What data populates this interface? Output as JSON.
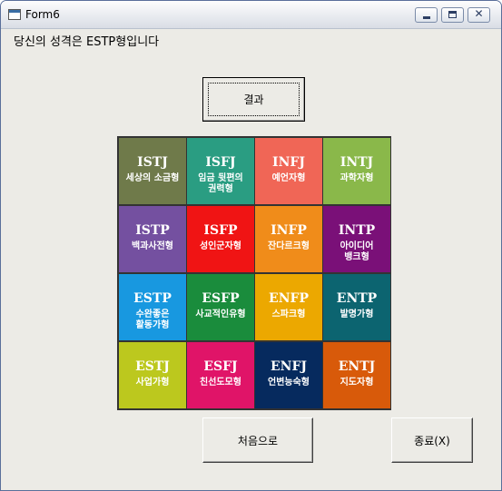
{
  "window": {
    "title": "Form6"
  },
  "title_icons": {
    "app": "form-icon",
    "minimize": "minimize-icon",
    "maximize": "maximize-icon",
    "close": "close-icon"
  },
  "result_text": "당신의 성격은 ESTP형입니다",
  "buttons": {
    "result": "결과",
    "home": "처음으로",
    "exit": "종료(X)"
  },
  "types": [
    {
      "code": "ISTJ",
      "desc": "세상의 소금형",
      "color": "#6f7a4a"
    },
    {
      "code": "ISFJ",
      "desc": "임금 뒷편의\n권력형",
      "color": "#2a9d82"
    },
    {
      "code": "INFJ",
      "desc": "예언자형",
      "color": "#f06656"
    },
    {
      "code": "INTJ",
      "desc": "과학자형",
      "color": "#8ab84a"
    },
    {
      "code": "ISTP",
      "desc": "백과사전형",
      "color": "#7450a0"
    },
    {
      "code": "ISFP",
      "desc": "성인군자형",
      "color": "#f01414"
    },
    {
      "code": "INFP",
      "desc": "잔다르크형",
      "color": "#f08c1a"
    },
    {
      "code": "INTP",
      "desc": "아이디어\n뱅크형",
      "color": "#7a1078"
    },
    {
      "code": "ESTP",
      "desc": "수완좋은\n활동가형",
      "color": "#1898e0"
    },
    {
      "code": "ESFP",
      "desc": "사교적인유형",
      "color": "#1a8c3c"
    },
    {
      "code": "ENFP",
      "desc": "스파크형",
      "color": "#eca800"
    },
    {
      "code": "ENTP",
      "desc": "발명가형",
      "color": "#0c6470"
    },
    {
      "code": "ESTJ",
      "desc": "사업가형",
      "color": "#bcc81e"
    },
    {
      "code": "ESFJ",
      "desc": "친선도모형",
      "color": "#e01468"
    },
    {
      "code": "ENFJ",
      "desc": "언변능숙형",
      "color": "#062a5e"
    },
    {
      "code": "ENTJ",
      "desc": "지도자형",
      "color": "#d85a0a"
    }
  ]
}
